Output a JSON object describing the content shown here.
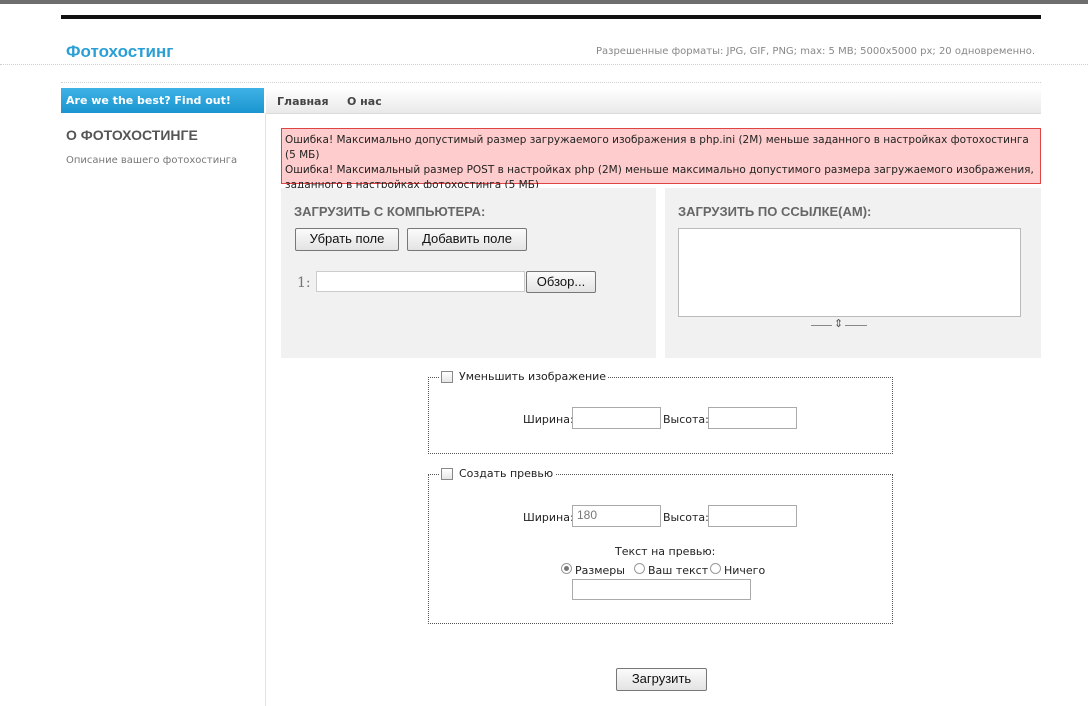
{
  "header": {
    "logo": "Фотохостинг",
    "formats": "Разрешенные форматы: JPG, GIF, PNG; max: 5 MB; 5000x5000 px; 20 одновременно."
  },
  "sidebar": {
    "promo": "Are we the best? Find out!",
    "title": "О ФОТОХОСТИНГЕ",
    "description": "Описание вашего фотохостинга"
  },
  "nav": {
    "items": [
      "Главная",
      "О нас"
    ]
  },
  "errors": [
    "Ошибка! Максимально допустимый размер загружаемого изображения в php.ini (2M) меньше заданного в настройках фотохостинга (5 МБ)",
    "Ошибка! Максимальный размер POST в настройках php (2M) меньше максимально допустимого размера загружаемого изображения, заданного в настройках фотохостинга (5 МБ)"
  ],
  "upload_computer": {
    "title": "ЗАГРУЗИТЬ С КОМПЬЮТЕРА:",
    "remove_field": "Убрать поле",
    "add_field": "Добавить поле",
    "field_number": "1:",
    "browse": "Обзор..."
  },
  "upload_url": {
    "title": "ЗАГРУЗИТЬ ПО ССЫЛКЕ(АМ):",
    "value": ""
  },
  "resize": {
    "checkbox_label": "Уменьшить изображение",
    "checked": false,
    "width_label": "Ширина:",
    "width_value": "",
    "height_label": "Высота:",
    "height_value": ""
  },
  "preview": {
    "checkbox_label": "Создать превью",
    "checked": false,
    "width_label": "Ширина:",
    "width_value": "180",
    "height_label": "Высота:",
    "height_value": "",
    "text_label": "Текст на превью:",
    "options": [
      "Размеры",
      "Ваш текст",
      "Ничего"
    ],
    "selected_option": "Размеры",
    "text_value": ""
  },
  "submit": "Загрузить",
  "colors": {
    "accent": "#2a9fd6",
    "error_bg": "#fecccc",
    "error_border": "#dd4444"
  }
}
